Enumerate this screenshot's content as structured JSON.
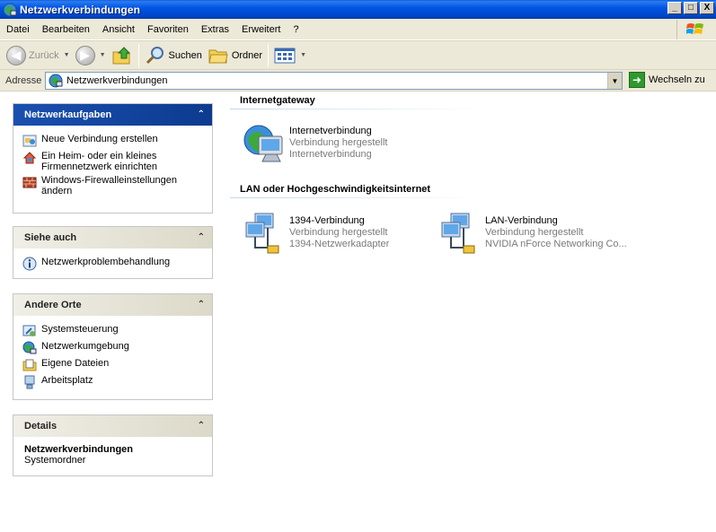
{
  "window": {
    "title": "Netzwerkverbindungen",
    "controls": [
      "_",
      "□",
      "X"
    ]
  },
  "menubar": {
    "items": [
      "Datei",
      "Bearbeiten",
      "Ansicht",
      "Favoriten",
      "Extras",
      "Erweitert",
      "?"
    ]
  },
  "toolbar": {
    "back_label": "Zurück",
    "search_label": "Suchen",
    "folders_label": "Ordner"
  },
  "address": {
    "label": "Adresse",
    "value": "Netzwerkverbindungen",
    "go_label": "Wechseln zu"
  },
  "sidebar": {
    "network_tasks": {
      "title": "Netzwerkaufgaben",
      "items": [
        "Neue Verbindung erstellen",
        "Ein Heim- oder ein kleines Firmennetzwerk einrichten",
        "Windows-Firewalleinstellungen ändern"
      ]
    },
    "see_also": {
      "title": "Siehe auch",
      "items": [
        "Netzwerkproblembehandlung"
      ]
    },
    "other_places": {
      "title": "Andere Orte",
      "items": [
        "Systemsteuerung",
        "Netzwerkumgebung",
        "Eigene Dateien",
        "Arbeitsplatz"
      ]
    },
    "details": {
      "title": "Details",
      "name": "Netzwerkverbindungen",
      "type": "Systemordner"
    }
  },
  "main": {
    "groups": [
      {
        "title": "Internetgateway",
        "items": [
          {
            "name": "Internetverbindung",
            "status": "Verbindung hergestellt",
            "device": "Internetverbindung"
          }
        ]
      },
      {
        "title": "LAN oder Hochgeschwindigkeitsinternet",
        "items": [
          {
            "name": "1394-Verbindung",
            "status": "Verbindung hergestellt",
            "device": "1394-Netzwerkadapter"
          },
          {
            "name": "LAN-Verbindung",
            "status": "Verbindung hergestellt",
            "device": "NVIDIA nForce Networking Co..."
          }
        ]
      }
    ]
  }
}
